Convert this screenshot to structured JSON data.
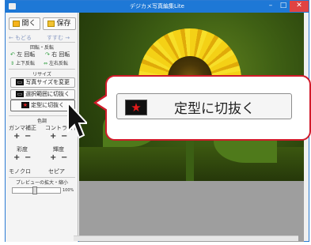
{
  "window": {
    "title": "デジカメ写真編集Lite",
    "min": "–",
    "max": "□",
    "close": "✕"
  },
  "toolbar": {
    "open": "開く",
    "save": "保存"
  },
  "history": {
    "undo": "← もどる",
    "redo": "すすむ →"
  },
  "rotate": {
    "header": "回転・反転",
    "rotate_left": "左 回転",
    "rotate_right": "右 回転",
    "flip_vertical": "上下反転",
    "flip_horizontal": "左右反転"
  },
  "resize": {
    "header": "リサイズ",
    "change_size": "写真サイズを変更",
    "crop_selection": "選択範囲に切抜く",
    "crop_shape": "定型に切抜く"
  },
  "color": {
    "header": "色調",
    "gamma": "ガンマ補正",
    "contrast": "コントラスト",
    "saturation": "彩度",
    "brightness": "輝度",
    "plus": "+",
    "minus": "−",
    "mono": "モノクロ",
    "sepia": "セピア"
  },
  "preview": {
    "header": "プレビューの拡大・縮小",
    "zoom": "100%"
  },
  "callout": {
    "label": "定型に切抜く"
  },
  "icons": {
    "open": "folder-open-icon",
    "save": "save-icon",
    "star": "★"
  },
  "colors": {
    "titlebar": "#1e78d6",
    "callout_border": "#d11a2a",
    "star": "#e02020",
    "link_blue": "#1a4fb6"
  }
}
